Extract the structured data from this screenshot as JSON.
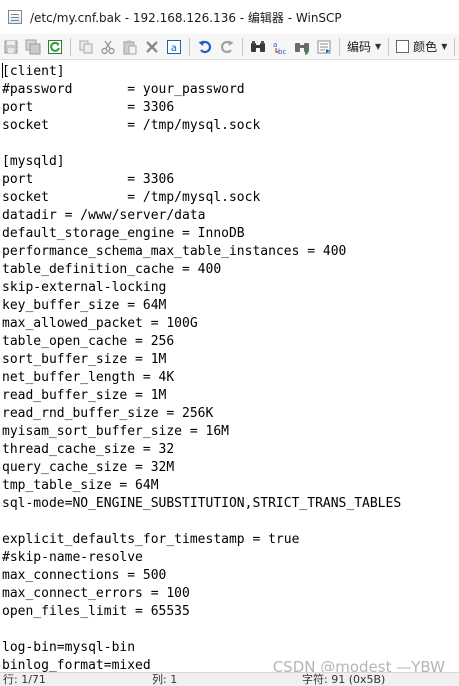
{
  "window": {
    "title": "/etc/my.cnf.bak - 192.168.126.136 - 编辑器 - WinSCP"
  },
  "toolbar": {
    "buttons": [
      "save-icon",
      "save-all-icon",
      "reload-icon",
      "copy-icon",
      "cut-icon",
      "paste-icon",
      "delete-icon",
      "select-all-icon",
      "undo-icon",
      "redo-icon",
      "find-icon",
      "replace-icon",
      "find-next-icon",
      "goto-line-icon"
    ],
    "encoding_label": "编码",
    "color_label": "颜色"
  },
  "editor": {
    "lines": [
      "[client]",
      "#password       = your_password",
      "port            = 3306",
      "socket          = /tmp/mysql.sock",
      "",
      "[mysqld]",
      "port            = 3306",
      "socket          = /tmp/mysql.sock",
      "datadir = /www/server/data",
      "default_storage_engine = InnoDB",
      "performance_schema_max_table_instances = 400",
      "table_definition_cache = 400",
      "skip-external-locking",
      "key_buffer_size = 64M",
      "max_allowed_packet = 100G",
      "table_open_cache = 256",
      "sort_buffer_size = 1M",
      "net_buffer_length = 4K",
      "read_buffer_size = 1M",
      "read_rnd_buffer_size = 256K",
      "myisam_sort_buffer_size = 16M",
      "thread_cache_size = 32",
      "query_cache_size = 32M",
      "tmp_table_size = 64M",
      "sql-mode=NO_ENGINE_SUBSTITUTION,STRICT_TRANS_TABLES",
      "",
      "explicit_defaults_for_timestamp = true",
      "#skip-name-resolve",
      "max_connections = 500",
      "max_connect_errors = 100",
      "open_files_limit = 65535",
      "",
      "log-bin=mysql-bin",
      "binlog_format=mixed"
    ]
  },
  "status": {
    "line": "行: 1/71",
    "column": "列: 1",
    "char": "字符: 91 (0x5B)"
  },
  "watermark": "CSDN @modest —YBW"
}
